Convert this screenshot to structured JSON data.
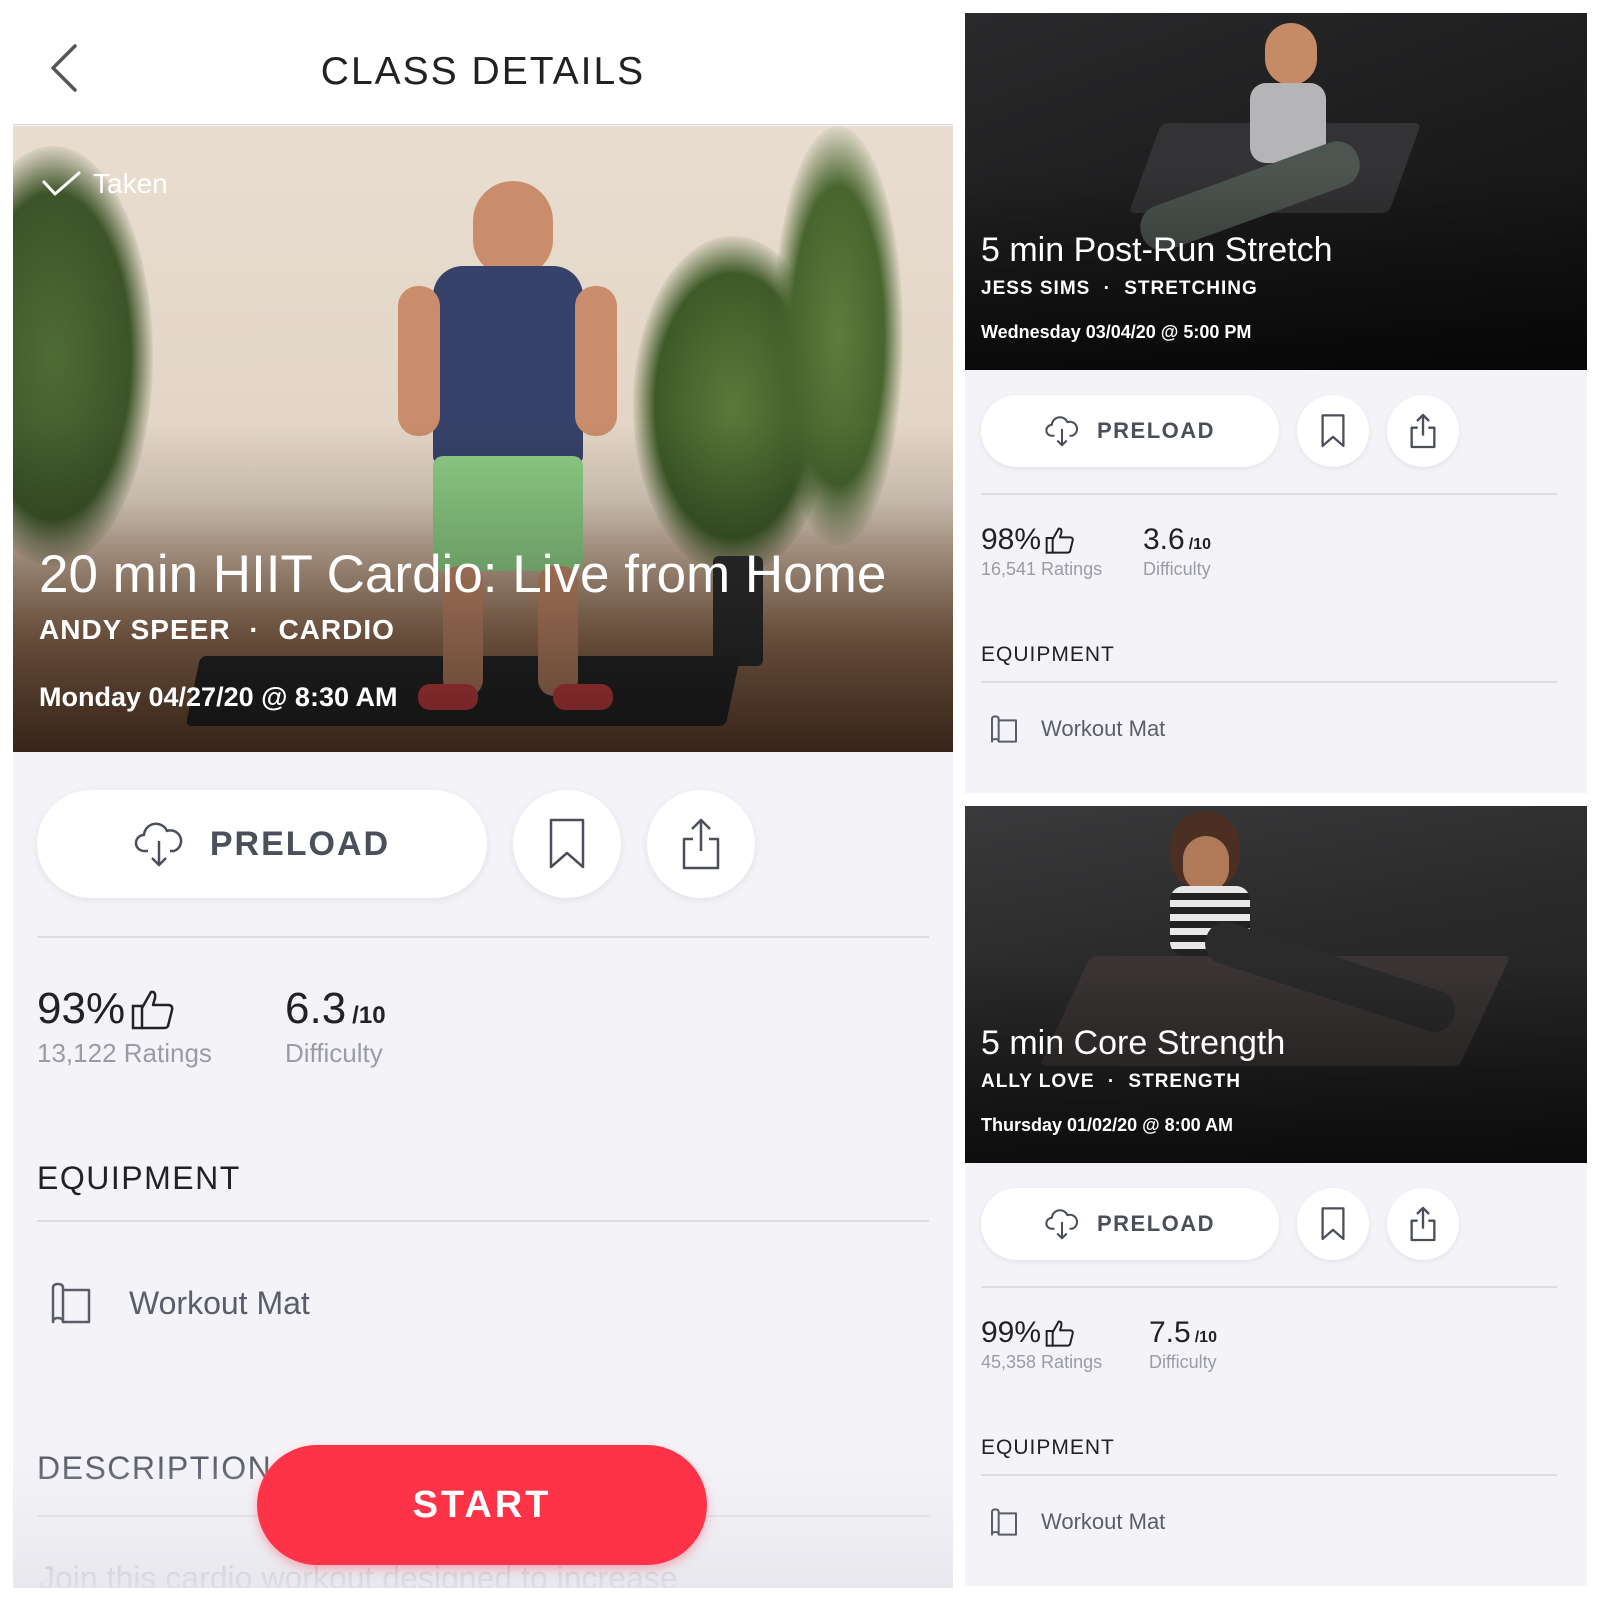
{
  "header": {
    "title": "CLASS DETAILS"
  },
  "main_class": {
    "taken_label": "Taken",
    "title": "20 min HIIT Cardio: Live from Home",
    "instructor": "ANDY SPEER",
    "separator": "·",
    "category": "CARDIO",
    "date": "Monday 04/27/20 @ 8:30 AM",
    "preload_label": "PRELOAD",
    "rating_percent": "93%",
    "ratings_count": "13,122 Ratings",
    "difficulty": "6.3",
    "difficulty_scale": "/10",
    "difficulty_label": "Difficulty",
    "equipment_heading": "EQUIPMENT",
    "equipment_item": "Workout Mat",
    "description_heading": "DESCRIPTION",
    "description_text": "Join this cardio workout designed to increase",
    "start_label": "START"
  },
  "cards": [
    {
      "title": "5 min Post-Run Stretch",
      "instructor": "JESS SIMS",
      "separator": "·",
      "category": "STRETCHING",
      "date": "Wednesday 03/04/20 @ 5:00 PM",
      "preload_label": "PRELOAD",
      "rating_percent": "98%",
      "ratings_count": "16,541 Ratings",
      "difficulty": "3.6",
      "difficulty_scale": "/10",
      "difficulty_label": "Difficulty",
      "equipment_heading": "EQUIPMENT",
      "equipment_item": "Workout Mat"
    },
    {
      "title": "5 min Core Strength",
      "instructor": "ALLY LOVE",
      "separator": "·",
      "category": "STRENGTH",
      "date": "Thursday 01/02/20 @ 8:00 AM",
      "preload_label": "PRELOAD",
      "rating_percent": "99%",
      "ratings_count": "45,358 Ratings",
      "difficulty": "7.5",
      "difficulty_scale": "/10",
      "difficulty_label": "Difficulty",
      "equipment_heading": "EQUIPMENT",
      "equipment_item": "Workout Mat"
    }
  ],
  "icons": {
    "back": "chevron-left-icon",
    "taken": "checkmark-icon",
    "preload": "cloud-download-icon",
    "bookmark": "bookmark-icon",
    "share": "share-icon",
    "thumbs_up": "thumbs-up-icon",
    "mat": "workout-mat-icon"
  },
  "colors": {
    "accent": "#ff3347",
    "background": "#f4f4f8",
    "muted_text": "#9a9ca5"
  }
}
